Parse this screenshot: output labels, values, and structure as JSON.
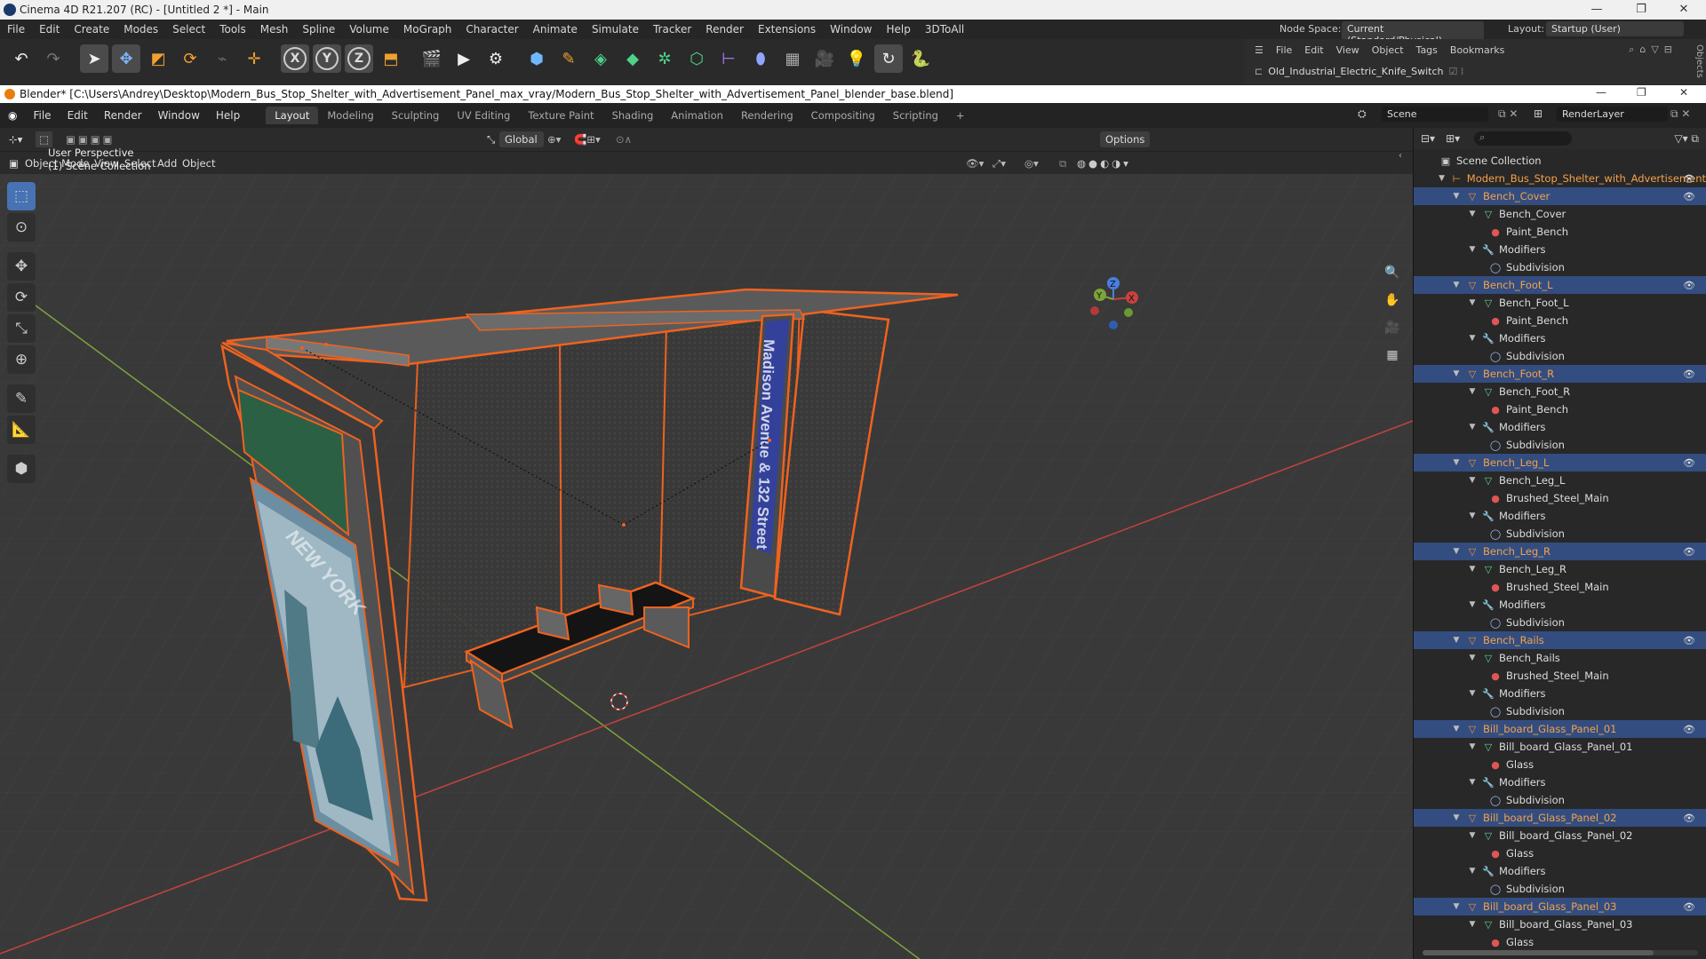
{
  "c4d": {
    "title": "Cinema 4D R21.207 (RC) - [Untitled 2 *] - Main",
    "menu": [
      "File",
      "Edit",
      "Create",
      "Modes",
      "Select",
      "Tools",
      "Mesh",
      "Spline",
      "Volume",
      "MoGraph",
      "Character",
      "Animate",
      "Simulate",
      "Tracker",
      "Render",
      "Extensions",
      "Window",
      "Help",
      "3DToAll"
    ],
    "node_space_label": "Node Space:",
    "node_space_value": "Current (Standard/Physical)",
    "layout_label": "Layout:",
    "layout_value": "Startup (User)",
    "objmgr_menu": [
      "File",
      "Edit",
      "View",
      "Object",
      "Tags",
      "Bookmarks"
    ],
    "objmgr_item": "Old_Industrial_Electric_Knife_Switch",
    "side_tab": "Objects"
  },
  "blender": {
    "title": "Blender* [C:\\Users\\Andrey\\Desktop\\Modern_Bus_Stop_Shelter_with_Advertisement_Panel_max_vray/Modern_Bus_Stop_Shelter_with_Advertisement_Panel_blender_base.blend]",
    "menu": [
      "File",
      "Edit",
      "Render",
      "Window",
      "Help"
    ],
    "workspaces": [
      "Layout",
      "Modeling",
      "Sculpting",
      "UV Editing",
      "Texture Paint",
      "Shading",
      "Animation",
      "Rendering",
      "Compositing",
      "Scripting"
    ],
    "active_workspace": "Layout",
    "scene": "Scene",
    "render_layer": "RenderLayer",
    "transform_orientation": "Global",
    "options_label": "Options",
    "mode": "Object Mode",
    "vp_menu": [
      "View",
      "Select",
      "Add",
      "Object"
    ],
    "vp_info_line1": "User Perspective",
    "vp_info_line2": "(1) Scene Collection",
    "sign_text": "Madison Avenue & 132 Street",
    "poster_text": "NEW YORK"
  },
  "outliner": {
    "root": "Scene Collection",
    "collection": "Modern_Bus_Stop_Shelter_with_Advertisement",
    "objects": [
      {
        "name": "Bench_Cover",
        "mesh": "Bench_Cover",
        "material": "Paint_Bench",
        "modifiers": "Modifiers",
        "modifier": "Subdivision"
      },
      {
        "name": "Bench_Foot_L",
        "mesh": "Bench_Foot_L",
        "material": "Paint_Bench",
        "modifiers": "Modifiers",
        "modifier": "Subdivision"
      },
      {
        "name": "Bench_Foot_R",
        "mesh": "Bench_Foot_R",
        "material": "Paint_Bench",
        "modifiers": "Modifiers",
        "modifier": "Subdivision"
      },
      {
        "name": "Bench_Leg_L",
        "mesh": "Bench_Leg_L",
        "material": "Brushed_Steel_Main",
        "modifiers": "Modifiers",
        "modifier": "Subdivision"
      },
      {
        "name": "Bench_Leg_R",
        "mesh": "Bench_Leg_R",
        "material": "Brushed_Steel_Main",
        "modifiers": "Modifiers",
        "modifier": "Subdivision"
      },
      {
        "name": "Bench_Rails",
        "mesh": "Bench_Rails",
        "material": "Brushed_Steel_Main",
        "modifiers": "Modifiers",
        "modifier": "Subdivision"
      },
      {
        "name": "Bill_board_Glass_Panel_01",
        "mesh": "Bill_board_Glass_Panel_01",
        "material": "Glass",
        "modifiers": "Modifiers",
        "modifier": "Subdivision"
      },
      {
        "name": "Bill_board_Glass_Panel_02",
        "mesh": "Bill_board_Glass_Panel_02",
        "material": "Glass",
        "modifiers": "Modifiers",
        "modifier": "Subdivision"
      },
      {
        "name": "Bill_board_Glass_Panel_03",
        "mesh": "Bill_board_Glass_Panel_03",
        "material": "Glass"
      }
    ]
  },
  "colors": {
    "selection_outline": "#f0621f",
    "highlight_row": "#334d80",
    "x_axis": "#c8423e",
    "y_axis": "#7ea33a"
  }
}
